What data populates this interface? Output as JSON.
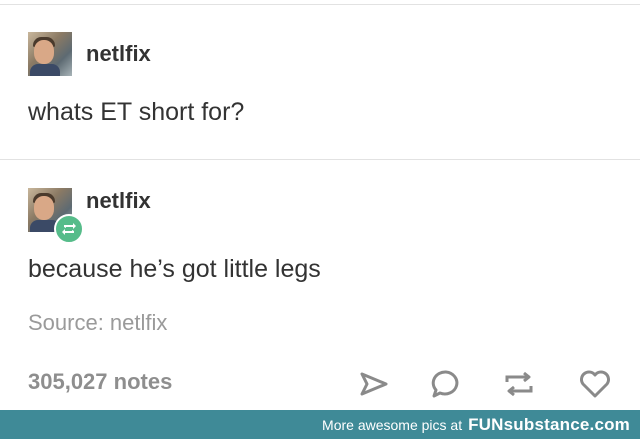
{
  "posts": [
    {
      "username": "netlfix",
      "text": "whats ET short for?"
    },
    {
      "username": "netlfix",
      "text": "because he’s got little legs"
    }
  ],
  "source_text": "Source: netlfix",
  "notes_text": "305,027 notes",
  "actions": [
    "share-icon",
    "reply-icon",
    "reblog-icon",
    "like-icon"
  ],
  "watermark": {
    "prefix": "More awesome pics at",
    "brand": "FUNsubstance.com"
  },
  "colors": {
    "reblog_badge": "#56bc8a",
    "footer_bg": "#3f8a97",
    "muted": "#8e8e8e"
  }
}
